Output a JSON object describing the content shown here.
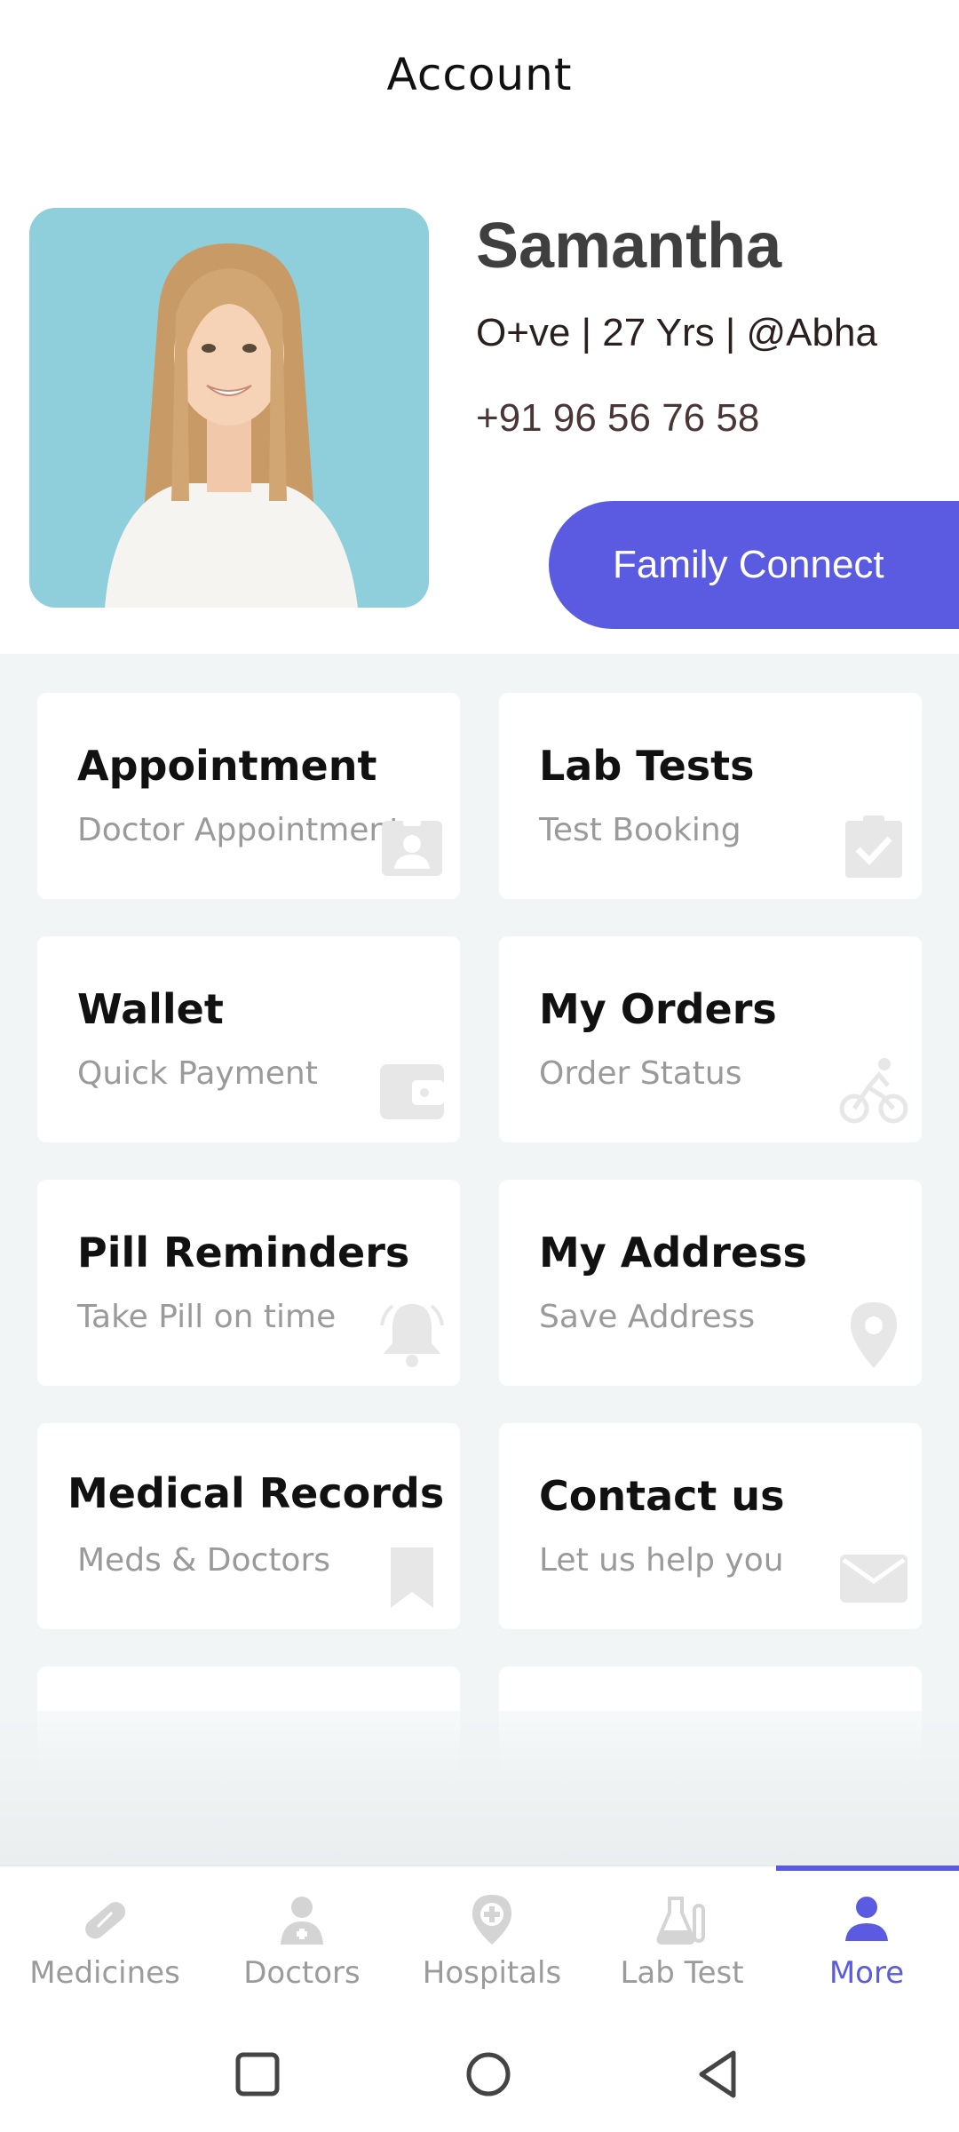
{
  "header": {
    "title": "Account"
  },
  "profile": {
    "name": "Samantha",
    "meta": "O+ve | 27 Yrs | @Abha",
    "phone": "+91 96 56 76 58",
    "family_button": "Family Connect"
  },
  "cards": [
    {
      "title": "Appointment",
      "subtitle": "Doctor Appointment",
      "icon": "contact-badge-icon"
    },
    {
      "title": "Lab Tests",
      "subtitle": "Test Booking",
      "icon": "clipboard-check-icon"
    },
    {
      "title": "Wallet",
      "subtitle": "Quick Payment",
      "icon": "wallet-icon"
    },
    {
      "title": "My Orders",
      "subtitle": "Order Status",
      "icon": "bicycle-rider-icon"
    },
    {
      "title": "Pill Reminders",
      "subtitle": "Take Pill on time",
      "icon": "bell-icon"
    },
    {
      "title": "My Address",
      "subtitle": "Save Address",
      "icon": "location-pin-icon"
    },
    {
      "title": "Medical Records",
      "subtitle": "Meds & Doctors",
      "icon": "bookmark-icon"
    },
    {
      "title": "Contact us",
      "subtitle": "Let us help you",
      "icon": "envelope-icon"
    }
  ],
  "bottom_nav": [
    {
      "label": "Medicines",
      "icon": "pill-icon"
    },
    {
      "label": "Doctors",
      "icon": "doctor-icon"
    },
    {
      "label": "Hospitals",
      "icon": "hospital-pin-icon"
    },
    {
      "label": "Lab Test",
      "icon": "lab-flask-icon"
    },
    {
      "label": "More",
      "icon": "person-icon",
      "active": true
    }
  ],
  "colors": {
    "accent": "#5a5be0",
    "grid_bg": "#f1f5f6",
    "icon_muted": "#e7e7e7"
  }
}
